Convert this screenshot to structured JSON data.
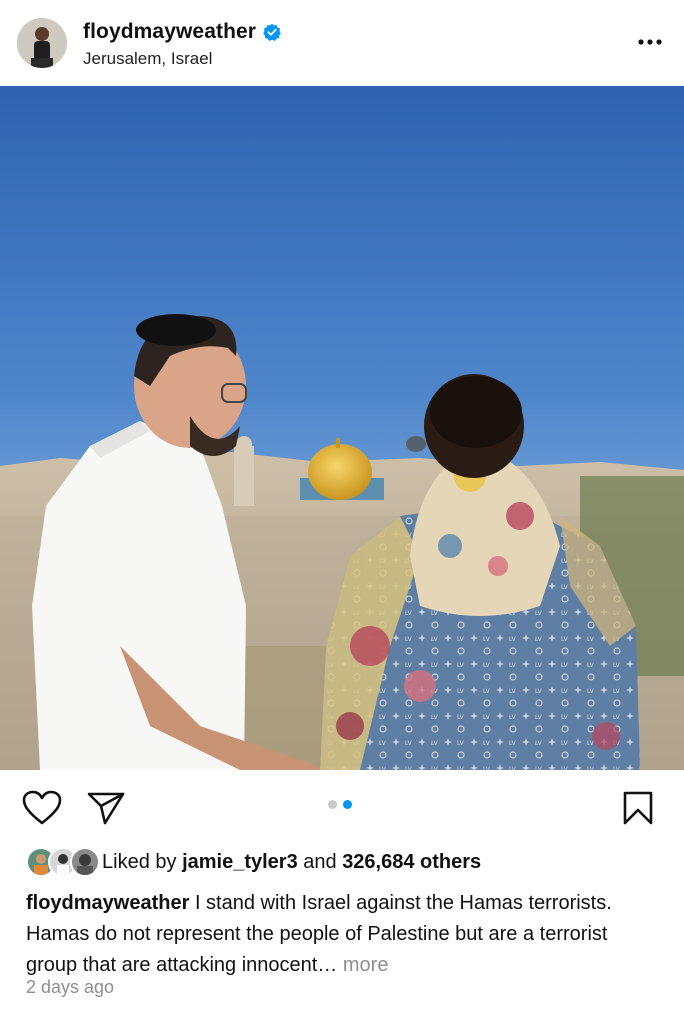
{
  "post": {
    "username": "floydmayweather",
    "verified": true,
    "location": "Jerusalem, Israel"
  },
  "actions": {
    "carousel_total": 2,
    "carousel_active": 2
  },
  "likes": {
    "prefix": "Liked by ",
    "first_liker": "jamie_tyler3",
    "middle": " and ",
    "others": "326,684 others"
  },
  "caption": {
    "username": "floydmayweather",
    "text": " I stand with Israel against the Hamas terrorists. Hamas do not represent the people of Palestine but are a terrorist group that are attacking innocent… ",
    "more": "more"
  },
  "timestamp": "2 days ago",
  "colors": {
    "accent": "#0095f6",
    "verified": "#0095f6",
    "secondary_text": "#8e8e8e"
  },
  "icons": {
    "like": "heart-outline-icon",
    "share": "paper-plane-icon",
    "save": "bookmark-outline-icon",
    "more": "three-dots-icon"
  }
}
